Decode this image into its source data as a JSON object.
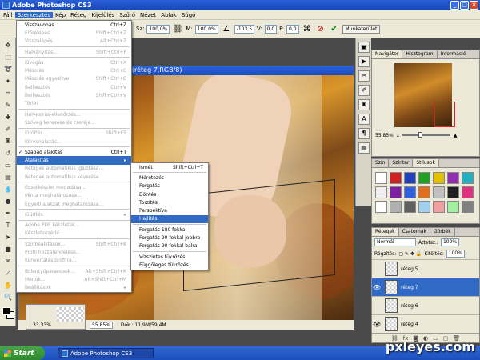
{
  "window": {
    "title": "Adobe Photoshop CS3"
  },
  "menubar": [
    "Fájl",
    "Szerkesztés",
    "Kép",
    "Réteg",
    "Kijelölés",
    "Szűrő",
    "Nézet",
    "Ablak",
    "Súgó"
  ],
  "options": {
    "w_label": "Sz:",
    "w_value": "100,0%",
    "h_label": "M:",
    "h_value": "100,0%",
    "angle_value": "-103,5",
    "h_skew_label": "V:",
    "h_skew_value": "0,0",
    "v_skew_label": "F:",
    "v_skew_value": "0,0",
    "workspace": "Munkaterület"
  },
  "document": {
    "title": "5,9% (réteg 7,RGB/8)",
    "zoom": "55,85%",
    "doc_info": "Dok.: 11,9M/59,4M"
  },
  "small_doc": {
    "zoom": "33,33%"
  },
  "edit_menu": [
    {
      "label": "Visszavonás",
      "shortcut": "Ctrl+Z",
      "disabled": false
    },
    {
      "label": "Előrelépés",
      "shortcut": "Shift+Ctrl+Z",
      "disabled": true
    },
    {
      "label": "Visszalépés",
      "shortcut": "Alt+Ctrl+Z",
      "disabled": true
    },
    {
      "sep": true
    },
    {
      "label": "Halványítás...",
      "shortcut": "Shift+Ctrl+F",
      "disabled": true
    },
    {
      "sep": true
    },
    {
      "label": "Kivágás",
      "shortcut": "Ctrl+X",
      "disabled": true
    },
    {
      "label": "Másolás",
      "shortcut": "Ctrl+C",
      "disabled": true
    },
    {
      "label": "Másolás egyesítve",
      "shortcut": "Shift+Ctrl+C",
      "disabled": true
    },
    {
      "label": "Beillesztés",
      "shortcut": "Ctrl+V",
      "disabled": true
    },
    {
      "label": "Beillesztés",
      "shortcut": "Shift+Ctrl+V",
      "disabled": true
    },
    {
      "label": "Törlés",
      "shortcut": "",
      "disabled": true
    },
    {
      "sep": true
    },
    {
      "label": "Helyesírás-ellenőrzés...",
      "shortcut": "",
      "disabled": true
    },
    {
      "label": "Szöveg keresése és cseréje...",
      "shortcut": "",
      "disabled": true
    },
    {
      "sep": true
    },
    {
      "label": "Kitöltés...",
      "shortcut": "Shift+F5",
      "disabled": true
    },
    {
      "label": "Körvonalazás...",
      "shortcut": "",
      "disabled": true
    },
    {
      "sep": true
    },
    {
      "label": "Szabad alakítás",
      "shortcut": "Ctrl+T",
      "disabled": false,
      "checked": true
    },
    {
      "label": "Átalakítás",
      "shortcut": "",
      "disabled": false,
      "highlighted": true,
      "submenu": true
    },
    {
      "label": "Rétegek automatikus igazítása...",
      "shortcut": "",
      "disabled": true
    },
    {
      "label": "Rétegek automatikus keverése",
      "shortcut": "",
      "disabled": true
    },
    {
      "sep": true
    },
    {
      "label": "Ecsetkészlet megadása...",
      "shortcut": "",
      "disabled": true
    },
    {
      "label": "Minta meghatározása...",
      "shortcut": "",
      "disabled": true
    },
    {
      "label": "Egyedi alakzat meghatározása...",
      "shortcut": "",
      "disabled": true
    },
    {
      "sep": true
    },
    {
      "label": "Kiürítés",
      "shortcut": "",
      "disabled": true,
      "submenu": true
    },
    {
      "sep": true
    },
    {
      "label": "Adobe PDF készletek...",
      "shortcut": "",
      "disabled": true
    },
    {
      "label": "Készletvezérlő...",
      "shortcut": "",
      "disabled": true
    },
    {
      "sep": true
    },
    {
      "label": "Színbeállítások...",
      "shortcut": "Shift+Ctrl+K",
      "disabled": true
    },
    {
      "label": "Profil hozzárendelése...",
      "shortcut": "",
      "disabled": true
    },
    {
      "label": "Konvertálás profilra...",
      "shortcut": "",
      "disabled": true
    },
    {
      "sep": true
    },
    {
      "label": "Billentyűparancsok...",
      "shortcut": "Alt+Shift+Ctrl+K",
      "disabled": true
    },
    {
      "label": "Menük...",
      "shortcut": "Alt+Shift+Ctrl+M",
      "disabled": true
    },
    {
      "label": "Beállítások",
      "shortcut": "",
      "disabled": true,
      "submenu": true
    }
  ],
  "transform_submenu": [
    {
      "label": "Ismét",
      "shortcut": "Shift+Ctrl+T"
    },
    {
      "sep": true
    },
    {
      "label": "Méretezés",
      "shortcut": ""
    },
    {
      "label": "Forgatás",
      "shortcut": ""
    },
    {
      "label": "Döntés",
      "shortcut": ""
    },
    {
      "label": "Torzítás",
      "shortcut": ""
    },
    {
      "label": "Perspektíva",
      "shortcut": ""
    },
    {
      "label": "Hajlítás",
      "shortcut": "",
      "highlighted": true
    },
    {
      "sep": true
    },
    {
      "label": "Forgatás 180 fokkal",
      "shortcut": ""
    },
    {
      "label": "Forgatás 90 fokkal jobbra",
      "shortcut": ""
    },
    {
      "label": "Forgatás 90 fokkal balra",
      "shortcut": ""
    },
    {
      "sep": true
    },
    {
      "label": "Vízszintes tükrözés",
      "shortcut": ""
    },
    {
      "label": "Függőleges tükrözés",
      "shortcut": ""
    }
  ],
  "navigator_panel": {
    "tabs": [
      "Navigátor",
      "Hisztogram",
      "Információ"
    ],
    "zoom": "55,85%"
  },
  "styles_panel": {
    "tabs": [
      "Szín",
      "Színtár",
      "Stílusok"
    ],
    "swatch_colors": [
      "#ffffff",
      "#d02020",
      "#2040c0",
      "#20a020",
      "#e0c000",
      "#9030b0",
      "#20b0c0",
      "#f0f0f0",
      "#8020a0",
      "#3060e0",
      "#e07020",
      "#c0c0c0",
      "#202020",
      "#e03080",
      "#ffffff",
      "#b0b0b0",
      "#606060",
      "#a0d0f0",
      "#f0a0a0",
      "#a0f0a0",
      "#808080"
    ]
  },
  "layers_panel": {
    "tabs": [
      "Rétegek",
      "Csatornák",
      "Görbék"
    ],
    "blend_mode": "Normál",
    "opacity_label": "Áttetsz.:",
    "opacity_value": "100%",
    "lock_label": "Rögzítés:",
    "fill_label": "Kitöltés:",
    "fill_value": "100%",
    "layers": [
      {
        "name": "réteg 5",
        "visible": false,
        "selected": false
      },
      {
        "name": "réteg 7",
        "visible": true,
        "selected": true
      },
      {
        "name": "réteg 6",
        "visible": false,
        "selected": false
      },
      {
        "name": "réteg 4",
        "visible": true,
        "selected": false
      }
    ]
  },
  "taskbar": {
    "start": "Start",
    "task": "Adobe Photoshop CS3"
  },
  "watermark": "pxleyes.com"
}
